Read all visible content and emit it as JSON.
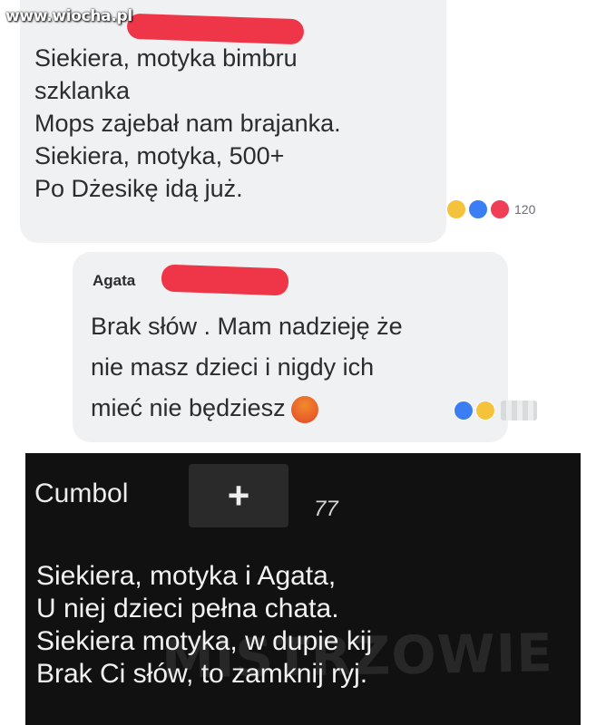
{
  "watermark": "www.wiocha.pl",
  "comment1": {
    "lines": [
      "Siekiera, motyka bimbru",
      "szklanka",
      "Mops zajebał nam brajanka.",
      "Siekiera, motyka, 500+",
      "Po Dżesikę idą już."
    ],
    "reaction_count": "120",
    "reactions": [
      "haha-icon",
      "like-icon",
      "love-icon"
    ]
  },
  "comment2": {
    "author": "Agata",
    "lines": [
      "Brak słów . Mam nadzieję że",
      "nie masz dzieci i nigdy ich",
      "mieć nie będziesz"
    ],
    "reactions": [
      "like-icon",
      "haha-icon"
    ]
  },
  "reply": {
    "author": "Cumbol",
    "plus_label": "+",
    "score": "77",
    "lines": [
      "Siekiera, motyka i Agata,",
      "U niej dzieci pełna chata.",
      "Siekiera motyka, w dupie kij",
      "Brak Ci słów, to zamknij ryj."
    ],
    "watermark": "MISTRZOWIE"
  },
  "colors": {
    "bubble": "#f0f1f3",
    "redaction": "#ee2b3e",
    "dark_panel": "#111111"
  }
}
